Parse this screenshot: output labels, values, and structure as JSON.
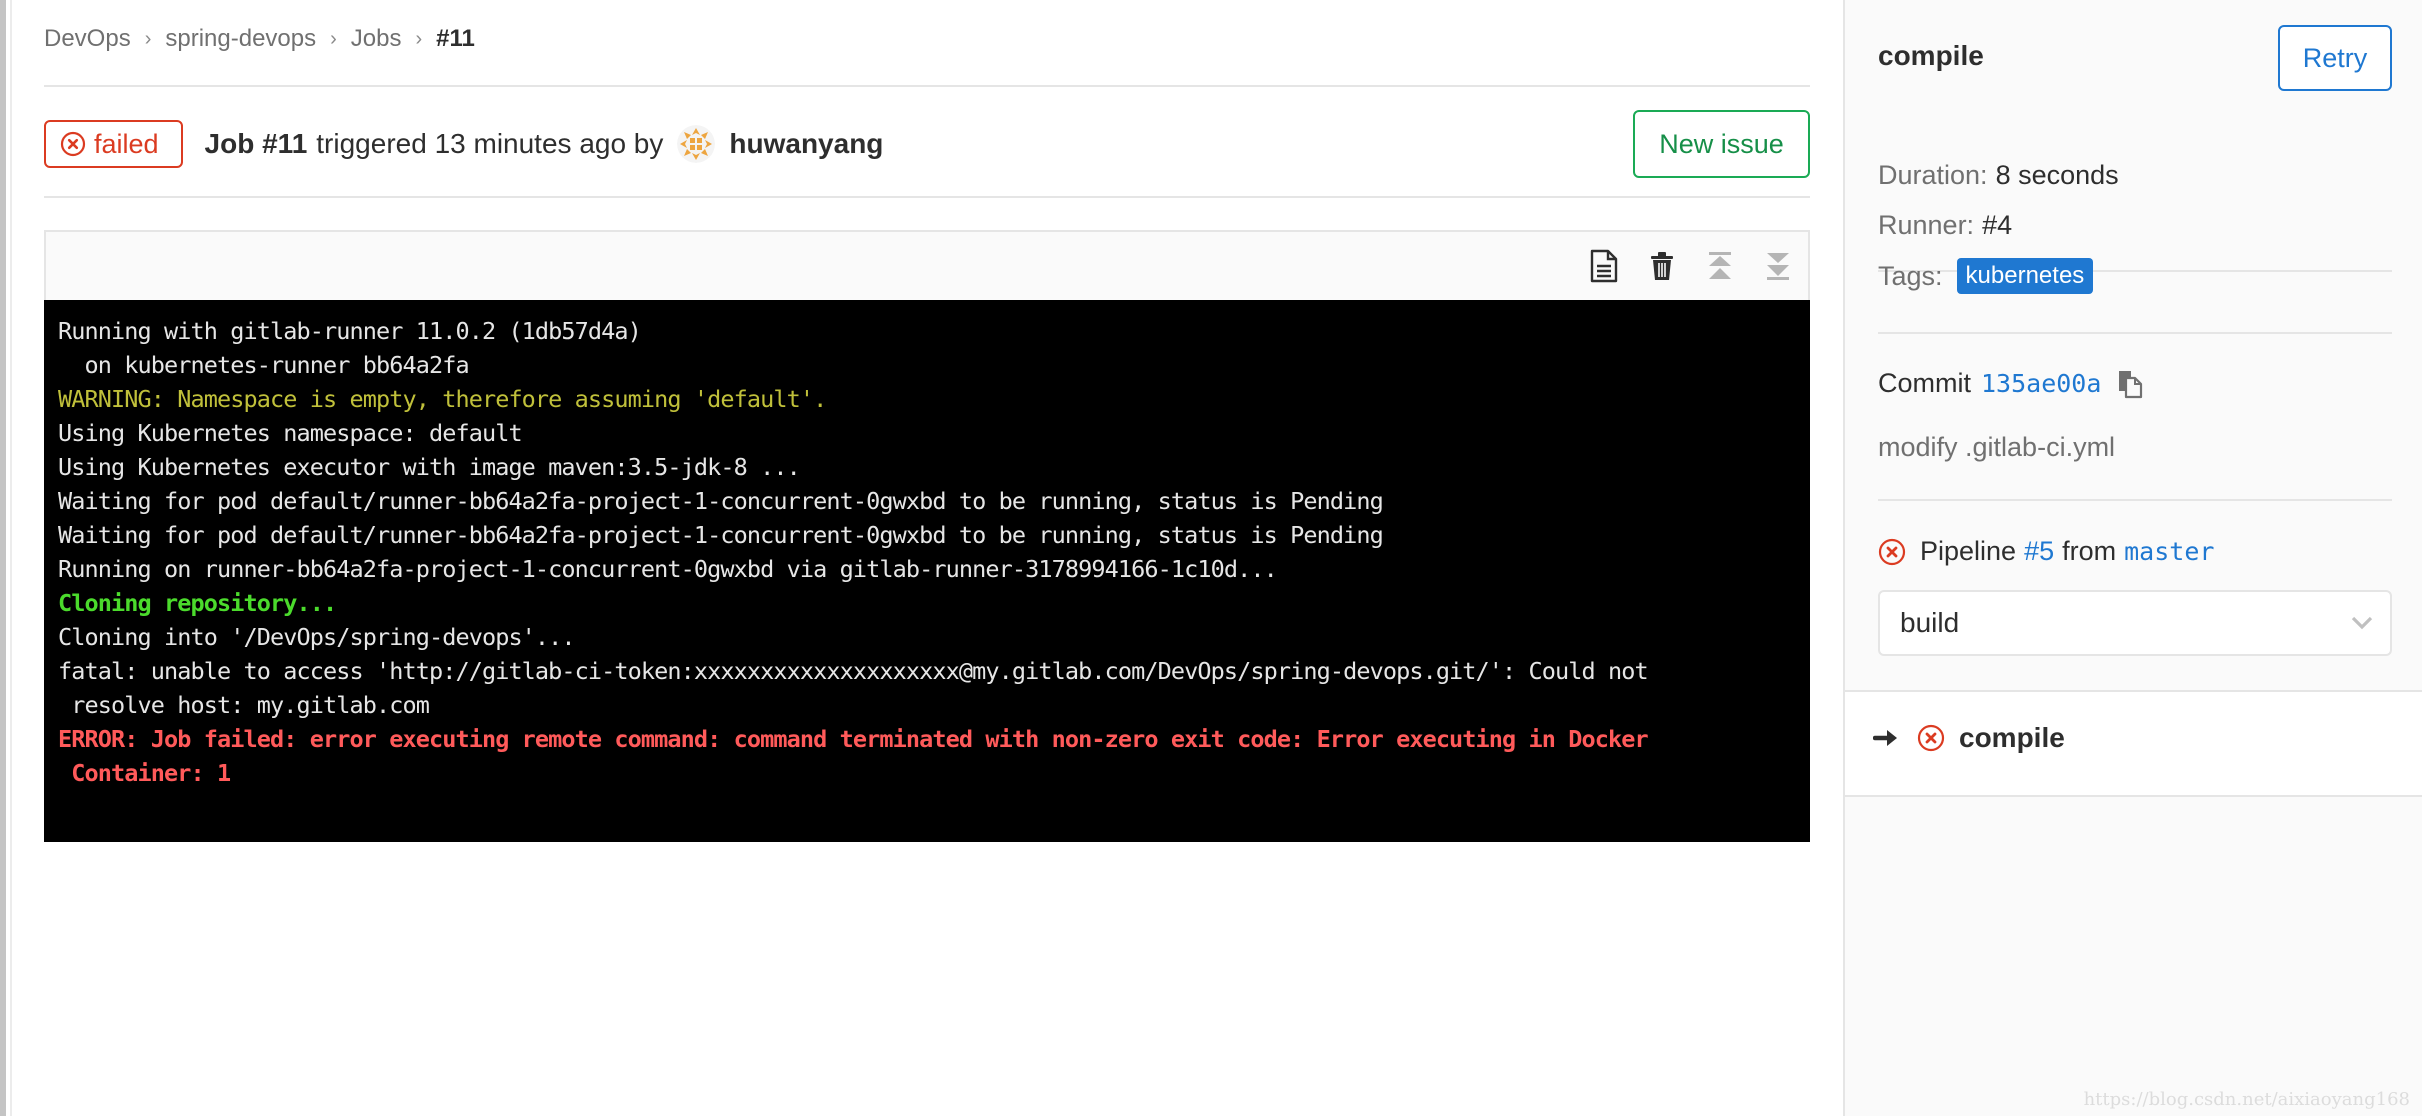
{
  "breadcrumb": [
    {
      "label": "DevOps"
    },
    {
      "label": "spring-devops"
    },
    {
      "label": "Jobs"
    },
    {
      "label": "#11"
    }
  ],
  "breadcrumb_separator": "›",
  "job_header": {
    "status": "failed",
    "job_label": "Job #11",
    "triggered_text": "triggered 13 minutes ago by",
    "author": "huwanyang",
    "new_issue_label": "New issue"
  },
  "log_controls": [
    {
      "name": "raw-log-icon",
      "label": "Show complete raw"
    },
    {
      "name": "erase-log-icon",
      "label": "Erase job log"
    },
    {
      "name": "scroll-top-icon",
      "label": "Scroll to top"
    },
    {
      "name": "scroll-bottom-icon",
      "label": "Scroll to bottom"
    }
  ],
  "log_lines": [
    {
      "text": "Running with gitlab-runner 11.0.2 (1db57d4a)",
      "style": "default"
    },
    {
      "text": "  on kubernetes-runner bb64a2fa",
      "style": "default"
    },
    {
      "text": "WARNING: Namespace is empty, therefore assuming 'default'.",
      "style": "warning"
    },
    {
      "text": "Using Kubernetes namespace: default",
      "style": "default"
    },
    {
      "text": "Using Kubernetes executor with image maven:3.5-jdk-8 ...",
      "style": "default"
    },
    {
      "text": "Waiting for pod default/runner-bb64a2fa-project-1-concurrent-0gwxbd to be running, status is Pending",
      "style": "default"
    },
    {
      "text": "Waiting for pod default/runner-bb64a2fa-project-1-concurrent-0gwxbd to be running, status is Pending",
      "style": "default"
    },
    {
      "text": "Running on runner-bb64a2fa-project-1-concurrent-0gwxbd via gitlab-runner-3178994166-1c10d...",
      "style": "default"
    },
    {
      "text": "Cloning repository...",
      "style": "green"
    },
    {
      "text": "Cloning into '/DevOps/spring-devops'...",
      "style": "default"
    },
    {
      "text": "fatal: unable to access 'http://gitlab-ci-token:xxxxxxxxxxxxxxxxxxxx@my.gitlab.com/DevOps/spring-devops.git/': Could not",
      "style": "default"
    },
    {
      "text": " resolve host: my.gitlab.com",
      "style": "default"
    },
    {
      "text": "ERROR: Job failed: error executing remote command: command terminated with non-zero exit code: Error executing in Docker",
      "style": "red"
    },
    {
      "text": " Container: 1",
      "style": "red"
    }
  ],
  "sidebar": {
    "job_name": "compile",
    "retry_label": "Retry",
    "duration_label": "Duration:",
    "duration_value": "8 seconds",
    "runner_label": "Runner:",
    "runner_value": "#4",
    "tags_label": "Tags:",
    "tags": [
      "kubernetes"
    ],
    "commit_label": "Commit",
    "commit_sha": "135ae00a",
    "commit_message": "modify .gitlab-ci.yml",
    "pipeline_label": "Pipeline",
    "pipeline_id": "#5",
    "pipeline_from": "from",
    "pipeline_branch": "master",
    "stage_selected": "build",
    "jobs": [
      {
        "name": "compile",
        "status": "failed",
        "current": true
      }
    ]
  },
  "colors": {
    "failed": "#db3b21",
    "link": "#1f78d1",
    "success_outline": "#1aaa55",
    "log_warning": "#c0c03a",
    "log_green": "#4bdb2c",
    "log_red": "#ff5a5a"
  },
  "watermark": "https://blog.csdn.net/aixiaoyang168"
}
